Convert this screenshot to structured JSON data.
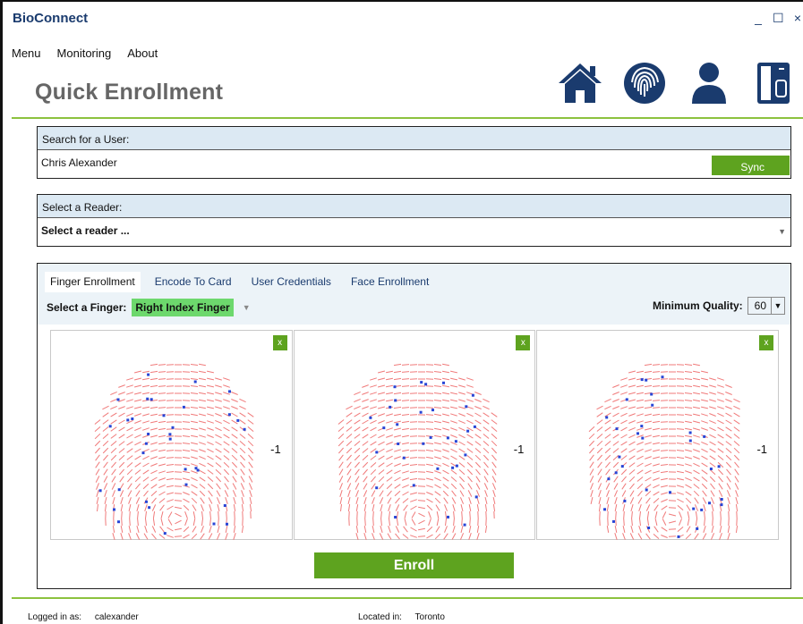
{
  "window": {
    "title": "BioConnect",
    "controls": {
      "minimize": "_",
      "maximize": "☐",
      "close": "×"
    }
  },
  "menu": [
    "Menu",
    "Monitoring",
    "About"
  ],
  "page_title": "Quick Enrollment",
  "nav_icons": [
    "home-icon",
    "fingerprint-icon",
    "user-icon",
    "reader-device-icon"
  ],
  "colors": {
    "brand_blue": "#1a3b6e",
    "accent_green": "#5ea31f",
    "rule_green": "#8cc23f",
    "selected_finger": "#6dd86d",
    "panel_header": "#dce9f3"
  },
  "search": {
    "label": "Search for a User:",
    "value": "Chris Alexander",
    "sync_label": "Sync"
  },
  "reader": {
    "label": "Select a Reader:",
    "value": "Select a reader ..."
  },
  "tabs": [
    {
      "label": "Finger Enrollment",
      "active": true
    },
    {
      "label": "Encode To Card",
      "active": false
    },
    {
      "label": "User Credentials",
      "active": false
    },
    {
      "label": "Face Enrollment",
      "active": false
    }
  ],
  "finger": {
    "label": "Select a Finger:",
    "value": "Right Index Finger"
  },
  "quality": {
    "label": "Minimum Quality:",
    "value": "60"
  },
  "samples": [
    {
      "close": "x",
      "score": "-1"
    },
    {
      "close": "x",
      "score": "-1"
    },
    {
      "close": "x",
      "score": "-1"
    }
  ],
  "enroll_label": "Enroll",
  "footer": {
    "logged_in_label": "Logged in as:",
    "logged_in_value": "calexander",
    "located_label": "Located in:",
    "located_value": "Toronto"
  }
}
